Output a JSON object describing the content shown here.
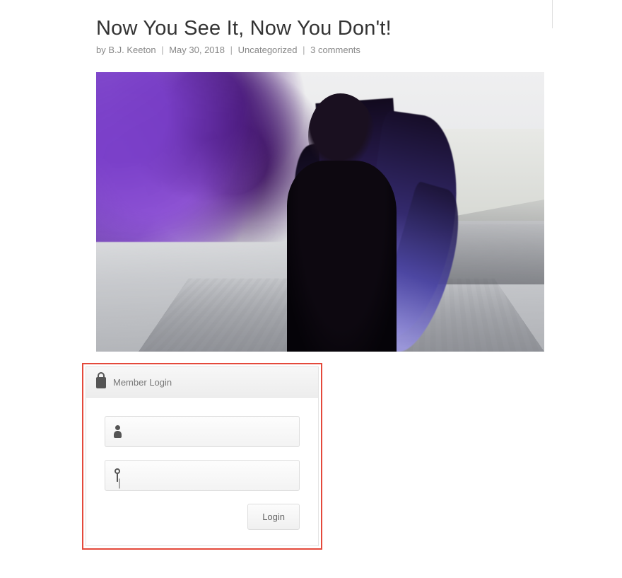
{
  "post": {
    "title": "Now You See It, Now You Don't!",
    "meta": {
      "by_label": "by",
      "author": "B.J. Keeton",
      "date": "May 30, 2018",
      "category": "Uncategorized",
      "comments": "3 comments"
    }
  },
  "login": {
    "title": "Member Login",
    "username_value": "",
    "password_value": "",
    "button_label": "Login"
  }
}
